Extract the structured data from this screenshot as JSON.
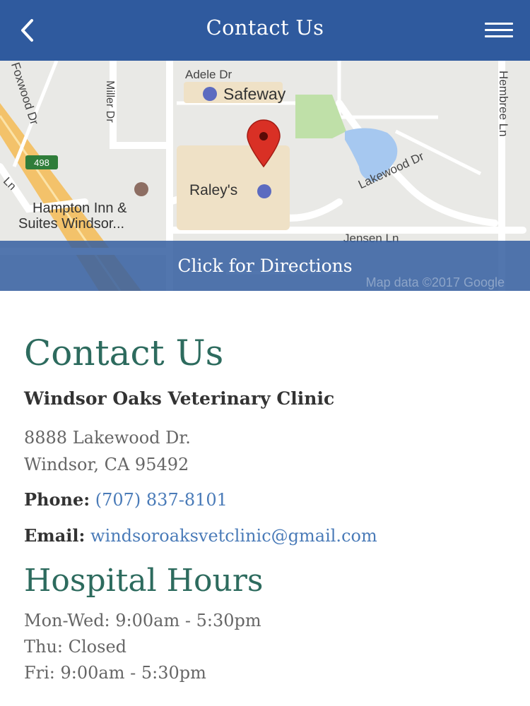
{
  "header": {
    "title": "Contact Us",
    "back_icon": "chevron-left-icon",
    "menu_icon": "hamburger-menu-icon"
  },
  "map": {
    "labels": {
      "adele": "Adele Dr",
      "safeway": "Safeway",
      "miller": "Miller Dr",
      "foxwood": "Foxwood Dr",
      "hembree": "Hembree Ln",
      "route": "498",
      "ln_left": "Ln",
      "raleys": "Raley's",
      "hampton1": "Hampton Inn &",
      "hampton2": "Suites Windsor...",
      "lakewood": "Lakewood Dr",
      "jensen": "Jensen Ln"
    },
    "directions_label": "Click for Directions",
    "credit": "Map data ©2017 Google",
    "colors": {
      "marker": "#d93025",
      "water": "#a6c8f0",
      "park": "#bfe0a8",
      "highway": "#f3c26a"
    }
  },
  "contact": {
    "heading": "Contact Us",
    "clinic_name": "Windsor Oaks Veterinary Clinic",
    "address_line1": "8888 Lakewood Dr.",
    "address_line2": "Windsor, CA 95492",
    "phone_label": "Phone:",
    "phone": "(707) 837-8101",
    "email_label": "Email:",
    "email": "windsoroaksvetclinic@gmail.com"
  },
  "hours": {
    "heading": "Hospital Hours",
    "lines": [
      "Mon-Wed: 9:00am - 5:30pm",
      "Thu: Closed",
      "Fri: 9:00am - 5:30pm"
    ]
  },
  "colors": {
    "header_bg": "#2f5a9e",
    "heading_green": "#2d6b5e",
    "link_blue": "#4a7bb8"
  }
}
